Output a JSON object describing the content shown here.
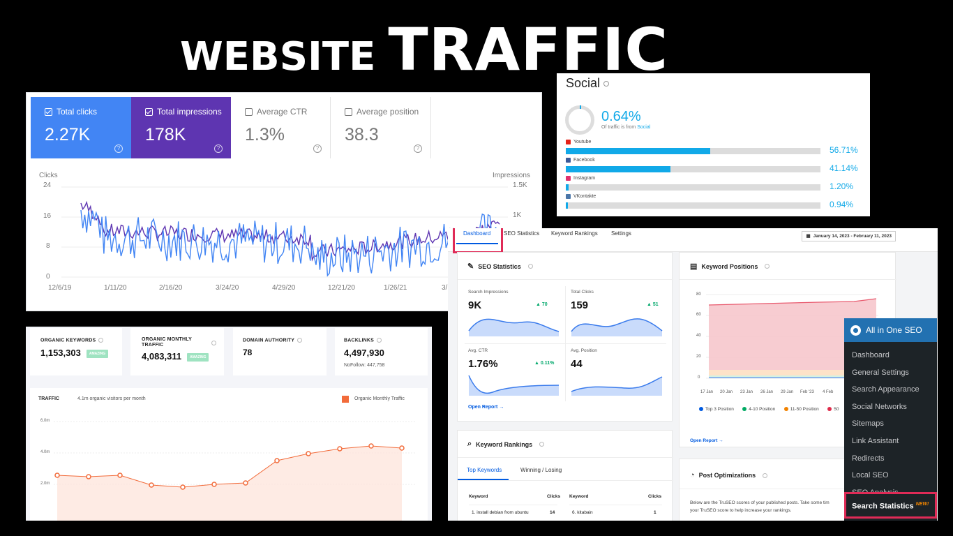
{
  "title": {
    "word1": "WEBSITE",
    "word2": "TRAFFIC"
  },
  "gsc": {
    "metrics": [
      {
        "label": "Total clicks",
        "value": "2.27K",
        "checked": true
      },
      {
        "label": "Total impressions",
        "value": "178K",
        "checked": true
      },
      {
        "label": "Average CTR",
        "value": "1.3%",
        "checked": false
      },
      {
        "label": "Average position",
        "value": "38.3",
        "checked": false
      }
    ],
    "left_axis_title": "Clicks",
    "right_axis_title": "Impressions",
    "left_ticks": [
      "24",
      "16",
      "8",
      "0"
    ],
    "right_ticks": [
      "1.5K",
      "1K"
    ],
    "x_ticks": [
      "12/6/19",
      "1/11/20",
      "2/16/20",
      "3/24/20",
      "4/29/20",
      "12/21/20",
      "1/26/21",
      "3/"
    ],
    "colors": {
      "clicks": "#4285f4",
      "impressions": "#5e35b1"
    }
  },
  "social": {
    "title": "Social",
    "headline": "0.64%",
    "sub_text": "Of traffic is from",
    "sub_link": "Social",
    "rows": [
      {
        "name": "Youtube",
        "pct_label": "56.71%",
        "value": 56.71,
        "icon_color": "#e62117"
      },
      {
        "name": "Facebook",
        "pct_label": "41.14%",
        "value": 41.14,
        "icon_color": "#3b5998"
      },
      {
        "name": "Instagram",
        "pct_label": "1.20%",
        "value": 1.2,
        "icon_color": "#e1306c"
      },
      {
        "name": "VKontakte",
        "pct_label": "0.94%",
        "value": 0.94,
        "icon_color": "#4a76a8"
      }
    ]
  },
  "sem": {
    "cards": [
      {
        "label": "ORGANIC KEYWORDS",
        "value": "1,153,303",
        "badge": "AMAZING"
      },
      {
        "label": "ORGANIC MONTHLY TRAFFIC",
        "value": "4,083,311",
        "badge": "AMAZING"
      },
      {
        "label": "DOMAIN AUTHORITY",
        "value": "78"
      },
      {
        "label": "BACKLINKS",
        "value": "4,497,930",
        "sub": "NoFollow: 447,758"
      }
    ],
    "traffic_title": "TRAFFIC",
    "traffic_subtitle": "4.1m organic visitors per month",
    "legend": "Organic Monthly Traffic",
    "y_ticks": [
      "6.0m",
      "4.0m",
      "2.0m"
    ],
    "color": "#f26b3a"
  },
  "aio": {
    "tabs": [
      "Dashboard",
      "SEO Statistics",
      "Keyword Rankings",
      "Settings"
    ],
    "date_range": "January 14, 2023 - February 11, 2023",
    "seo_stats": {
      "title": "SEO Statistics",
      "items": [
        {
          "label": "Search Impressions",
          "value": "9K",
          "delta": "70"
        },
        {
          "label": "Total Clicks",
          "value": "159",
          "delta": "51"
        },
        {
          "label": "Avg. CTR",
          "value": "1.76%",
          "delta": "0.11%"
        },
        {
          "label": "Avg. Position",
          "value": "44",
          "delta": ""
        }
      ],
      "open_report": "Open Report →"
    },
    "keyword_positions": {
      "title": "Keyword Positions",
      "y_ticks": [
        "80",
        "60",
        "40",
        "20",
        "0"
      ],
      "x_ticks": [
        "17 Jan",
        "20 Jan",
        "23 Jan",
        "26 Jan",
        "29 Jan",
        "Feb '23",
        "4 Feb"
      ],
      "legend": [
        {
          "label": "Top 3 Position",
          "color": "#005ae0"
        },
        {
          "label": "4-10 Position",
          "color": "#00aa63"
        },
        {
          "label": "11-50 Position",
          "color": "#f18200"
        },
        {
          "label": "50",
          "color": "#df2a4a"
        }
      ],
      "open_report": "Open Report →"
    },
    "keyword_rankings": {
      "title": "Keyword Rankings",
      "tabs": [
        "Top Keywords",
        "Winning / Losing"
      ],
      "headers": [
        "Keyword",
        "Clicks",
        "Keyword",
        "Clicks"
      ],
      "rows": [
        [
          "1. install debian from ubuntu",
          "14",
          "6. kitabain",
          "1"
        ]
      ]
    },
    "post_opt": {
      "title": "Post Optimizations",
      "line1": "Below are the TruSEO scores of your published posts. Take some tim",
      "line2": "your TruSEO score to help increase your rankings."
    }
  },
  "wp": {
    "header": "All in One SEO",
    "items": [
      "Dashboard",
      "General Settings",
      "Search Appearance",
      "Social Networks",
      "Sitemaps",
      "Link Assistant",
      "Redirects",
      "Local SEO",
      "SEO Analysis"
    ],
    "active_item": "Search Statistics",
    "active_badge": "NEW!"
  }
}
